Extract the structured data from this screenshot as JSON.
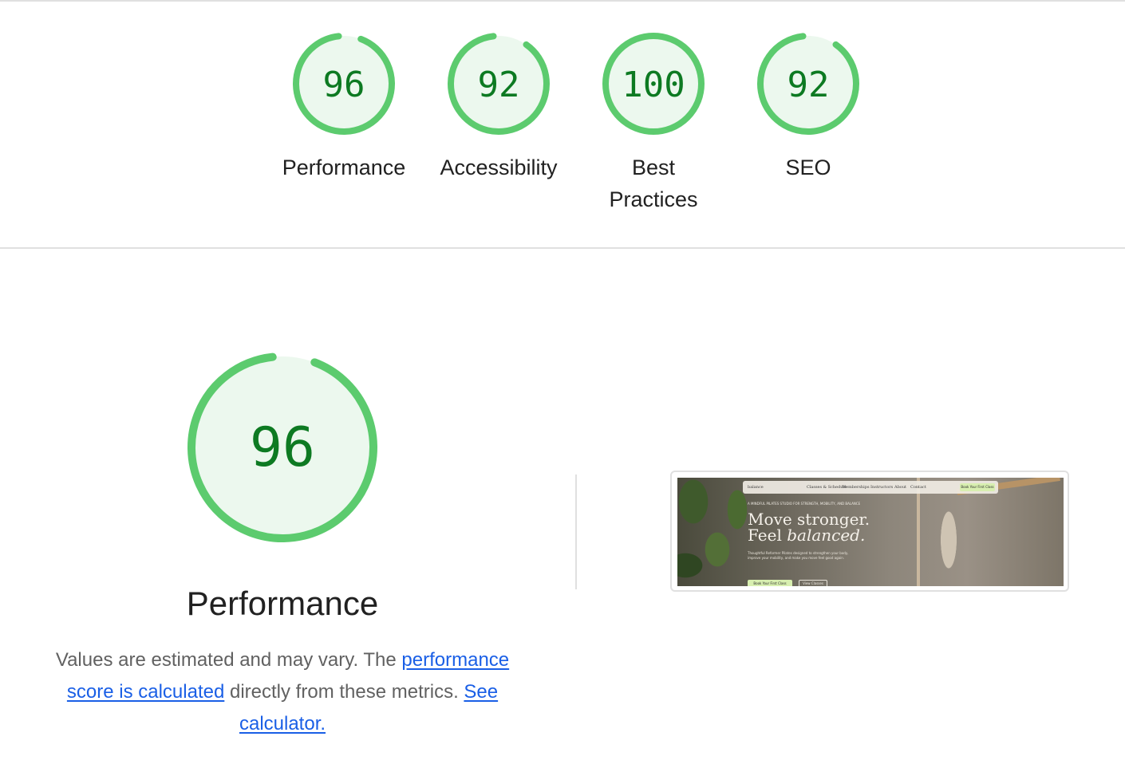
{
  "summary": {
    "gauges": [
      {
        "id": "performance",
        "score": 96,
        "label": "Performance"
      },
      {
        "id": "accessibility",
        "score": 92,
        "label": "Accessibility"
      },
      {
        "id": "best-practices",
        "score": 100,
        "label": "Best Practices"
      },
      {
        "id": "seo",
        "score": 92,
        "label": "SEO"
      }
    ]
  },
  "performance": {
    "score": 96,
    "title": "Performance",
    "desc_prefix": "Values are estimated and may vary. The ",
    "link_score_calculated": "performance score is calculated",
    "desc_middle": " directly from these metrics. ",
    "link_calculator": "See calculator."
  },
  "screenshot": {
    "nav_logo": "balance",
    "nav_items": [
      "Classes & Schedule",
      "Memberships",
      "Instructors",
      "About",
      "Contact"
    ],
    "nav_cta": "Book Your First Class",
    "kicker": "A MINDFUL PILATES STUDIO FOR STRENGTH, MOBILITY, AND BALANCE",
    "headline_line1": "Move stronger.",
    "headline_line2_plain": "Feel ",
    "headline_line2_italic": "balanced.",
    "body": "Thoughtful Reformer Pilates designed to strengthen your body, improve your mobility, and make you move feel good again.",
    "button_primary": "Book Your First Class",
    "button_secondary": "View Classes"
  },
  "colors": {
    "pass_stroke": "#0cce6b",
    "pass_fill": "#e6f8ec",
    "pass_text": "#0d7a22",
    "link": "#1a5fe6"
  }
}
